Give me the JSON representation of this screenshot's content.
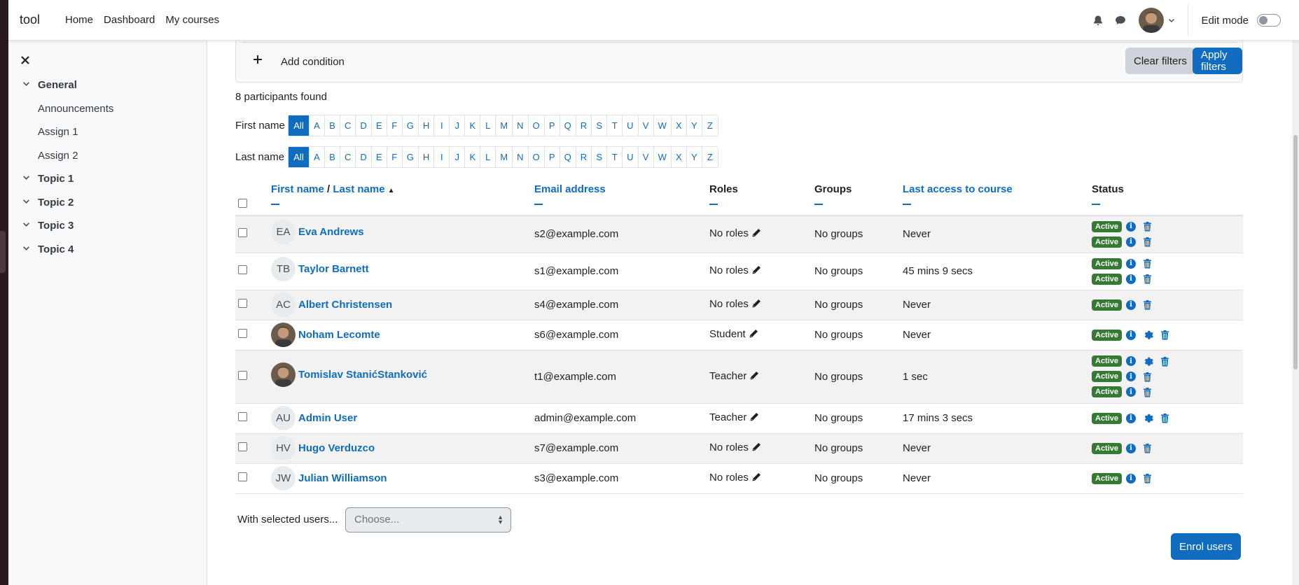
{
  "navbar": {
    "brand": "tool",
    "links": [
      "Home",
      "Dashboard",
      "My courses"
    ],
    "edit_mode_label": "Edit mode",
    "edit_mode_on": false
  },
  "drawer": {
    "close_icon": "close-icon",
    "items": [
      {
        "label": "General",
        "type": "section"
      },
      {
        "label": "Announcements",
        "type": "activity"
      },
      {
        "label": "Assign 1",
        "type": "activity"
      },
      {
        "label": "Assign 2",
        "type": "activity"
      },
      {
        "label": "Topic 1",
        "type": "section"
      },
      {
        "label": "Topic 2",
        "type": "section"
      },
      {
        "label": "Topic 3",
        "type": "section"
      },
      {
        "label": "Topic 4",
        "type": "section"
      }
    ]
  },
  "filters": {
    "add_condition": "Add condition",
    "clear": "Clear filters",
    "apply": "Apply filters"
  },
  "participants_found": "8 participants found",
  "initials_bar": {
    "first_name_label": "First name",
    "last_name_label": "Last name",
    "letters": [
      "All",
      "A",
      "B",
      "C",
      "D",
      "E",
      "F",
      "G",
      "H",
      "I",
      "J",
      "K",
      "L",
      "M",
      "N",
      "O",
      "P",
      "Q",
      "R",
      "S",
      "T",
      "U",
      "V",
      "W",
      "X",
      "Y",
      "Z"
    ],
    "selected": "All"
  },
  "table": {
    "headers": {
      "first_name": "First name",
      "separator": " / ",
      "last_name": "Last name",
      "email": "Email address",
      "roles": "Roles",
      "groups": "Groups",
      "last_access": "Last access to course",
      "status": "Status"
    },
    "rows": [
      {
        "initials": "EA",
        "photo": false,
        "name": "Eva Andrews",
        "email": "s2@example.com",
        "roles": "No roles",
        "groups": "No groups",
        "last_access": "Never",
        "status": [
          {
            "label": "Active",
            "actions": [
              "info",
              "delete"
            ]
          },
          {
            "label": "Active",
            "actions": [
              "info",
              "delete"
            ]
          }
        ]
      },
      {
        "initials": "TB",
        "photo": false,
        "name": "Taylor Barnett",
        "email": "s1@example.com",
        "roles": "No roles",
        "groups": "No groups",
        "last_access": "45 mins 9 secs",
        "status": [
          {
            "label": "Active",
            "actions": [
              "info",
              "delete"
            ]
          },
          {
            "label": "Active",
            "actions": [
              "info",
              "delete"
            ]
          }
        ]
      },
      {
        "initials": "AC",
        "photo": false,
        "name": "Albert Christensen",
        "email": "s4@example.com",
        "roles": "No roles",
        "groups": "No groups",
        "last_access": "Never",
        "status": [
          {
            "label": "Active",
            "actions": [
              "info",
              "delete"
            ]
          }
        ]
      },
      {
        "initials": "",
        "photo": true,
        "name": "Noham Lecomte",
        "email": "s6@example.com",
        "roles": "Student",
        "groups": "No groups",
        "last_access": "Never",
        "status": [
          {
            "label": "Active",
            "actions": [
              "info",
              "settings",
              "delete"
            ]
          }
        ]
      },
      {
        "initials": "",
        "photo": true,
        "name": "Tomislav StanićStanković",
        "email": "t1@example.com",
        "roles": "Teacher",
        "groups": "No groups",
        "last_access": "1 sec",
        "status": [
          {
            "label": "Active",
            "actions": [
              "info",
              "settings",
              "delete"
            ]
          },
          {
            "label": "Active",
            "actions": [
              "info",
              "delete"
            ]
          },
          {
            "label": "Active",
            "actions": [
              "info",
              "delete"
            ]
          }
        ]
      },
      {
        "initials": "AU",
        "photo": false,
        "name": "Admin User",
        "email": "admin@example.com",
        "roles": "Teacher",
        "groups": "No groups",
        "last_access": "17 mins 3 secs",
        "status": [
          {
            "label": "Active",
            "actions": [
              "info",
              "settings",
              "delete"
            ]
          }
        ]
      },
      {
        "initials": "HV",
        "photo": false,
        "name": "Hugo Verduzco",
        "email": "s7@example.com",
        "roles": "No roles",
        "groups": "No groups",
        "last_access": "Never",
        "status": [
          {
            "label": "Active",
            "actions": [
              "info",
              "delete"
            ]
          }
        ]
      },
      {
        "initials": "JW",
        "photo": false,
        "name": "Julian Williamson",
        "email": "s3@example.com",
        "roles": "No roles",
        "groups": "No groups",
        "last_access": "Never",
        "status": [
          {
            "label": "Active",
            "actions": [
              "info",
              "delete"
            ]
          }
        ]
      }
    ]
  },
  "bulk": {
    "label": "With selected users...",
    "select_placeholder": "Choose..."
  },
  "enrol_button": "Enrol users",
  "colors": {
    "primary": "#0f6cbf",
    "active_badge": "#357a32",
    "secondary_button": "#ced4da"
  }
}
